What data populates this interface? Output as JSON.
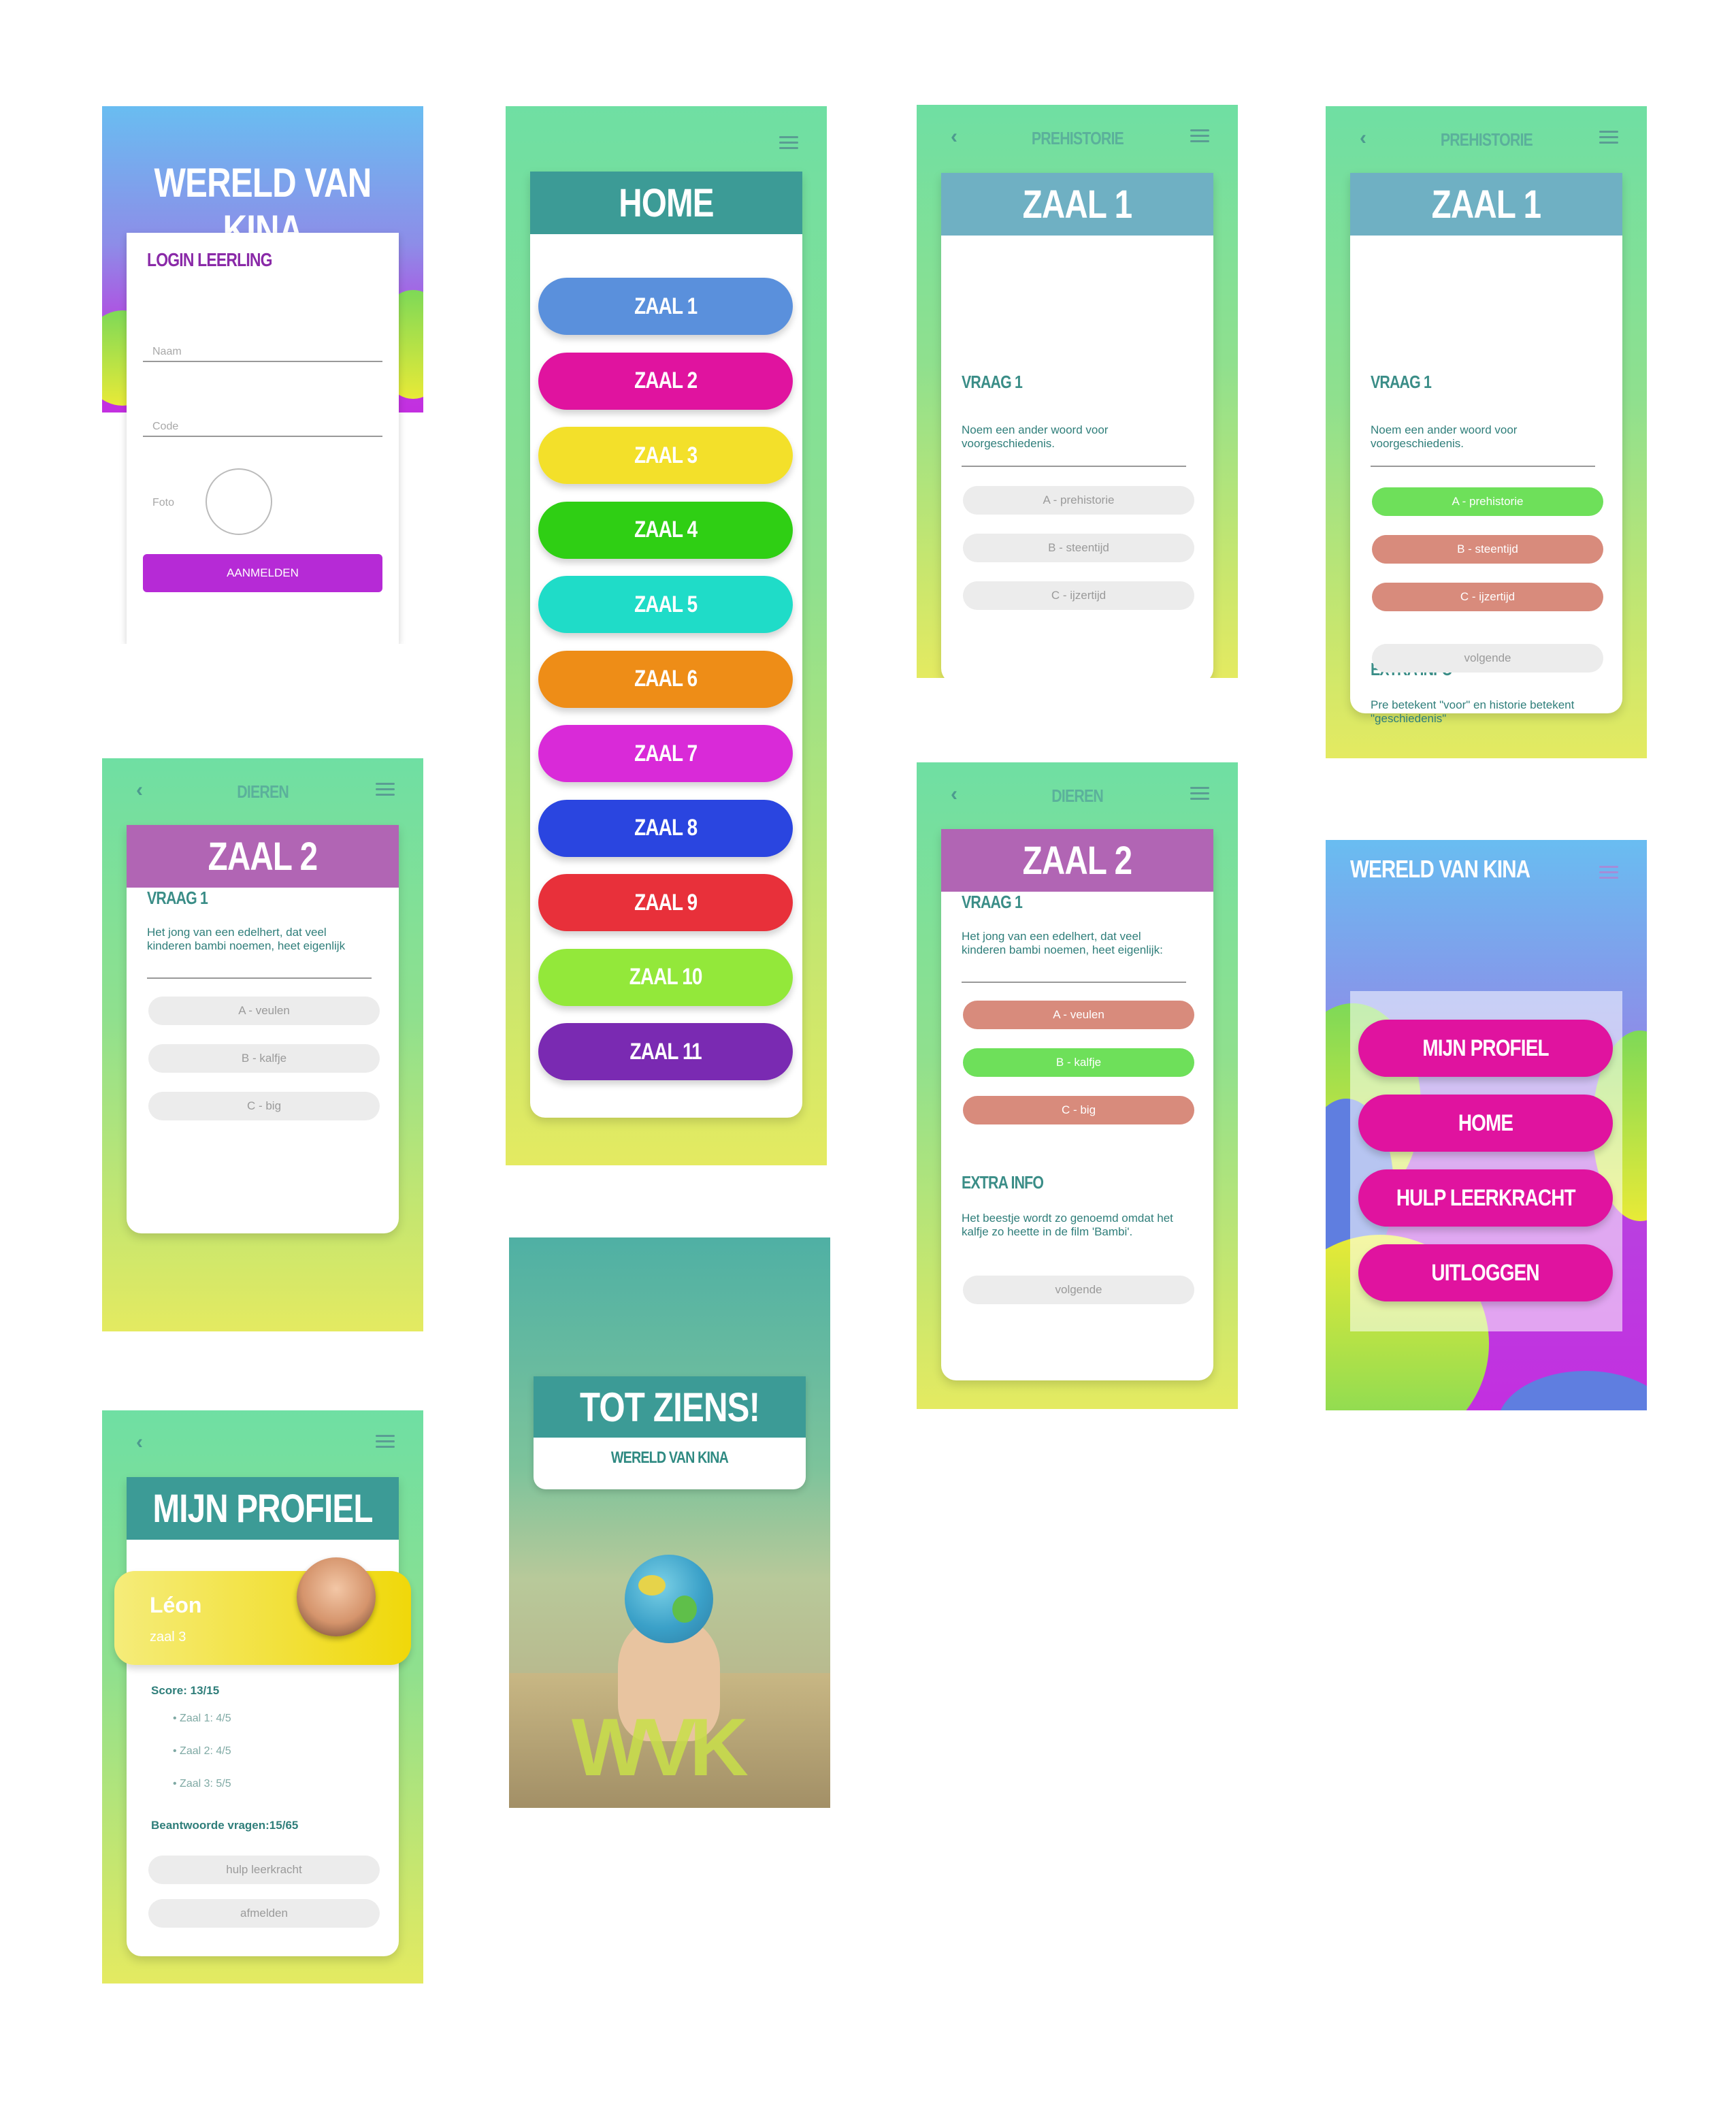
{
  "login": {
    "app_title": "WERELD VAN KINA",
    "heading": "LOGIN LEERLING",
    "name_placeholder": "Naam",
    "code_placeholder": "Code",
    "photo_label": "Foto",
    "submit_label": "AANMELDEN"
  },
  "home": {
    "title": "HOME",
    "rooms": [
      {
        "label": "ZAAL 1",
        "color": "#5a90dc"
      },
      {
        "label": "ZAAL 2",
        "color": "#e0139f"
      },
      {
        "label": "ZAAL 3",
        "color": "#f3e02a"
      },
      {
        "label": "ZAAL 4",
        "color": "#2fcf14"
      },
      {
        "label": "ZAAL 5",
        "color": "#1fdcc8"
      },
      {
        "label": "ZAAL 6",
        "color": "#ee8d17"
      },
      {
        "label": "ZAAL 7",
        "color": "#d92ad8"
      },
      {
        "label": "ZAAL 8",
        "color": "#2a45e0"
      },
      {
        "label": "ZAAL 9",
        "color": "#e8303a"
      },
      {
        "label": "ZAAL 10",
        "color": "#93e83a"
      },
      {
        "label": "ZAAL 11",
        "color": "#7a2ab2"
      }
    ]
  },
  "zaal1_q": {
    "nav_title": "PREHISTORIE",
    "title": "ZAAL 1",
    "question_label": "VRAAG 1",
    "question": "Noem een ander woord voor voorgeschiedenis.",
    "options": [
      "A - prehistorie",
      "B - steentijd",
      "C - ijzertijd"
    ]
  },
  "zaal1_a": {
    "nav_title": "PREHISTORIE",
    "title": "ZAAL 1",
    "question_label": "VRAAG 1",
    "question": "Noem een ander woord voor voorgeschiedenis.",
    "options": [
      "A - prehistorie",
      "B - steentijd",
      "C - ijzertijd"
    ],
    "extra_label": "EXTRA INFO",
    "extra_text": "Pre betekent \"voor\" en historie betekent \"geschiedenis\"",
    "next_label": "volgende"
  },
  "zaal2_q": {
    "nav_title": "DIEREN",
    "title": "ZAAL 2",
    "question_label": "VRAAG 1",
    "question": "Het jong van een edelhert, dat veel kinderen bambi noemen, heet eigenlijk",
    "options": [
      "A - veulen",
      "B - kalfje",
      "C - big"
    ]
  },
  "zaal2_a": {
    "nav_title": "DIEREN",
    "title": "ZAAL 2",
    "question_label": "VRAAG 1",
    "question": "Het jong van een edelhert, dat veel kinderen bambi noemen, heet eigenlijk:",
    "options": [
      "A - veulen",
      "B - kalfje",
      "C - big"
    ],
    "extra_label": "EXTRA INFO",
    "extra_text": "Het beestje wordt zo genoemd omdat het kalfje zo heette in de film 'Bambi'.",
    "next_label": "volgende"
  },
  "menu": {
    "title": "WERELD VAN KINA",
    "items": [
      "MIJN PROFIEL",
      "HOME",
      "HULP LEERKRACHT",
      "UITLOGGEN"
    ]
  },
  "profile": {
    "title": "MIJN PROFIEL",
    "name": "Léon",
    "room": "zaal 3",
    "score": "Score: 13/15",
    "scores": [
      "• Zaal 1: 4/5",
      "• Zaal 2: 4/5",
      "• Zaal 3: 5/5"
    ],
    "answered": "Beantwoorde vragen:15/65",
    "help_label": "hulp leerkracht",
    "logout_label": "afmelden"
  },
  "goodbye": {
    "title": "TOT ZIENS!",
    "subtitle": "WERELD VAN KINA",
    "logo": "WVK"
  },
  "colors": {
    "correct": "#6ee05a",
    "wrong": "#d88b7c",
    "zaal1_banner": "#6fb0c3",
    "zaal2_banner": "#b165b4",
    "home_banner": "#3c9b96",
    "primary_purple": "#b62ad6",
    "menu_pink": "#e0139f"
  }
}
